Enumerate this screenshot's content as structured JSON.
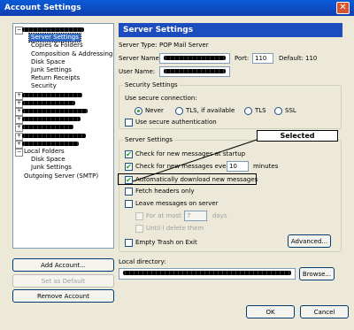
{
  "window": {
    "title": "Account Settings",
    "close_glyph": "✕"
  },
  "tree": {
    "items": [
      {
        "label": "",
        "redacted": true,
        "expanded": true
      },
      {
        "label": "Server Settings",
        "selected": true
      },
      {
        "label": "Copies & Folders"
      },
      {
        "label": "Composition & Addressing"
      },
      {
        "label": "Disk Space"
      },
      {
        "label": "Junk Settings"
      },
      {
        "label": "Return Receipts"
      },
      {
        "label": "Security"
      },
      {
        "label": "",
        "redacted": true
      },
      {
        "label": "",
        "redacted": true
      },
      {
        "label": "",
        "redacted": true
      },
      {
        "label": "",
        "redacted": true
      },
      {
        "label": "",
        "redacted": true
      },
      {
        "label": "",
        "redacted": true
      },
      {
        "label": "",
        "redacted": true
      },
      {
        "label": "Local Folders",
        "expanded": true
      },
      {
        "label": "Disk Space"
      },
      {
        "label": "Junk Settings"
      },
      {
        "label": "Outgoing Server (SMTP)"
      }
    ]
  },
  "left_buttons": {
    "add": "Add Account...",
    "set_default": "Set as Default",
    "remove": "Remove Account"
  },
  "panel": {
    "header": "Server Settings",
    "server_type_label": "Server Type:",
    "server_type_value": "POP Mail Server",
    "server_name_label": "Server Name:",
    "server_name_value": "",
    "port_label": "Port:",
    "port_value": "110",
    "default_label": "Default:",
    "default_value": "110",
    "user_name_label": "User Name:",
    "user_name_value": ""
  },
  "security": {
    "legend": "Security Settings",
    "connection_label": "Use secure connection:",
    "options": [
      "Never",
      "TLS, if available",
      "TLS",
      "SSL"
    ],
    "selected": "Never",
    "secure_auth": "Use secure authentication"
  },
  "server_settings": {
    "legend": "Server Settings",
    "check_startup": "Check for new messages at startup",
    "check_every": "Check for new messages every",
    "minutes_value": "10",
    "minutes_label": "minutes",
    "auto_download": "Automatically download new messages",
    "fetch_headers": "Fetch headers only",
    "leave_messages": "Leave messages on server",
    "for_at_most": "For at most",
    "days_value": "7",
    "days_label": "days",
    "until_delete": "Until I delete them",
    "empty_trash": "Empty Trash on Exit",
    "advanced": "Advanced..."
  },
  "local_directory": {
    "label": "Local directory:",
    "value": "",
    "browse": "Browse..."
  },
  "dialog_buttons": {
    "ok": "OK",
    "cancel": "Cancel"
  },
  "annotation": {
    "callout": "Selected"
  },
  "colors": {
    "titlebar": "#0f3fb0",
    "selection": "#316ac5",
    "check": "#21a121"
  }
}
